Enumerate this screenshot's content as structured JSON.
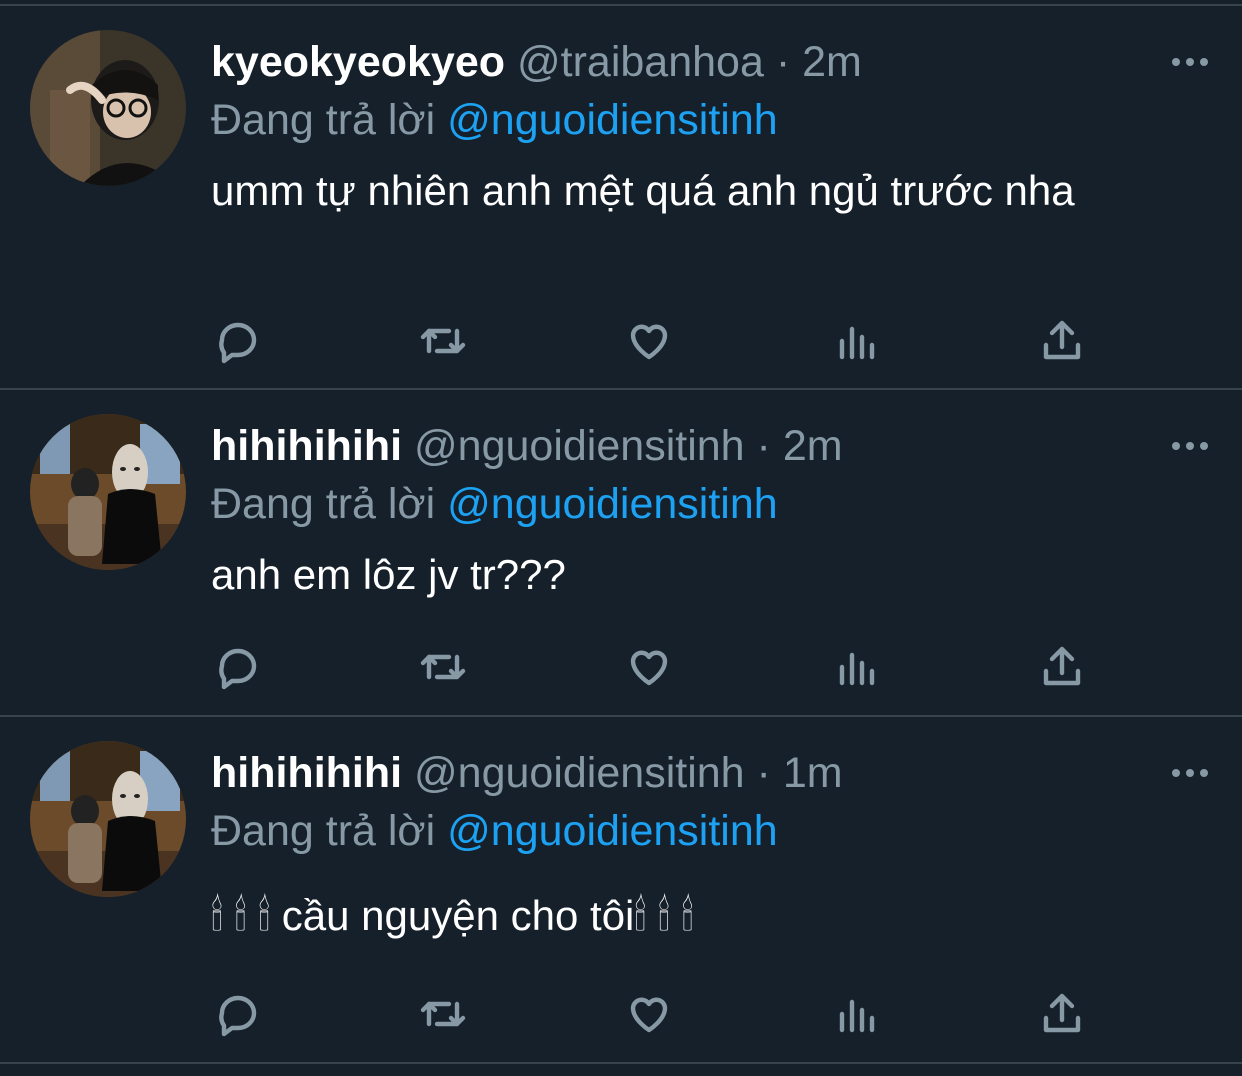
{
  "colors": {
    "background": "#15202b",
    "divider": "#38444d",
    "muted_text": "#8899a6",
    "link": "#1da1f2",
    "primary_text": "#ffffff"
  },
  "icons": {
    "more": "more-horizontal-icon",
    "reply": "reply-bubble-icon",
    "retweet": "retweet-arrows-icon",
    "like": "heart-icon",
    "views": "bar-chart-icon",
    "share": "share-upload-icon"
  },
  "tweets": [
    {
      "display_name": "kyeokyeokyeo",
      "handle": "@traibanhoa",
      "separator": "·",
      "time": "2m",
      "reply_prefix": "Đang trả lời",
      "reply_to": "@nguoidiensitinh",
      "text": "umm tự nhiên anh mệt quá anh ngủ trước nha"
    },
    {
      "display_name": "hihihihihi",
      "handle": "@nguoidiensitinh",
      "separator": "·",
      "time": "2m",
      "reply_prefix": "Đang trả lời",
      "reply_to": "@nguoidiensitinh",
      "text": "anh em lôz jv tr???"
    },
    {
      "display_name": "hihihihihi",
      "handle": "@nguoidiensitinh",
      "separator": "·",
      "time": "1m",
      "reply_prefix": "Đang trả lời",
      "reply_to": "@nguoidiensitinh",
      "text": "🕯 🕯 🕯 cầu nguyện cho tôi🕯 🕯 🕯"
    }
  ]
}
